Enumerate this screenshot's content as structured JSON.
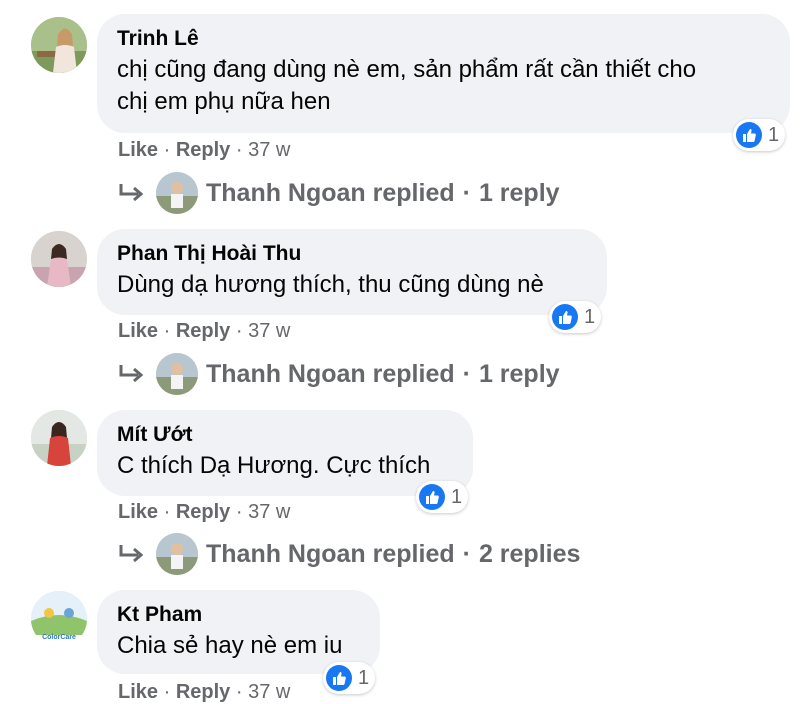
{
  "comments": [
    {
      "author": "Trinh Lê",
      "text_line1": "chị cũng đang dùng nè em, sản phẩm rất cần thiết cho",
      "text_line2": "chị em phụ nữa hen",
      "reaction_count": "1",
      "action_like": "Like",
      "action_reply": "Reply",
      "time": "37 w",
      "replies_author": "Thanh Ngoan replied",
      "replies_count": "1 reply"
    },
    {
      "author": "Phan Thị Hoài Thu",
      "text_line1": "Dùng dạ hương thích, thu cũng dùng nè",
      "reaction_count": "1",
      "action_like": "Like",
      "action_reply": "Reply",
      "time": "37 w",
      "replies_author": "Thanh Ngoan replied",
      "replies_count": "1 reply"
    },
    {
      "author": "Mít Ướt",
      "text_line1": "C thích Dạ Hương. Cực thích",
      "reaction_count": "1",
      "action_like": "Like",
      "action_reply": "Reply",
      "time": "37 w",
      "replies_author": "Thanh Ngoan replied",
      "replies_count": "2 replies"
    },
    {
      "author": "Kt Pham",
      "text_line1": "Chia sẻ hay nè em iu",
      "reaction_count": "1",
      "action_like": "Like",
      "action_reply": "Reply",
      "time": "37 w"
    }
  ],
  "separator": "·",
  "avatar_logo_text": "ColorCare",
  "colors": {
    "bubble": "#f0f2f5",
    "like_blue": "#1877f2",
    "meta_gray": "#65676b"
  }
}
